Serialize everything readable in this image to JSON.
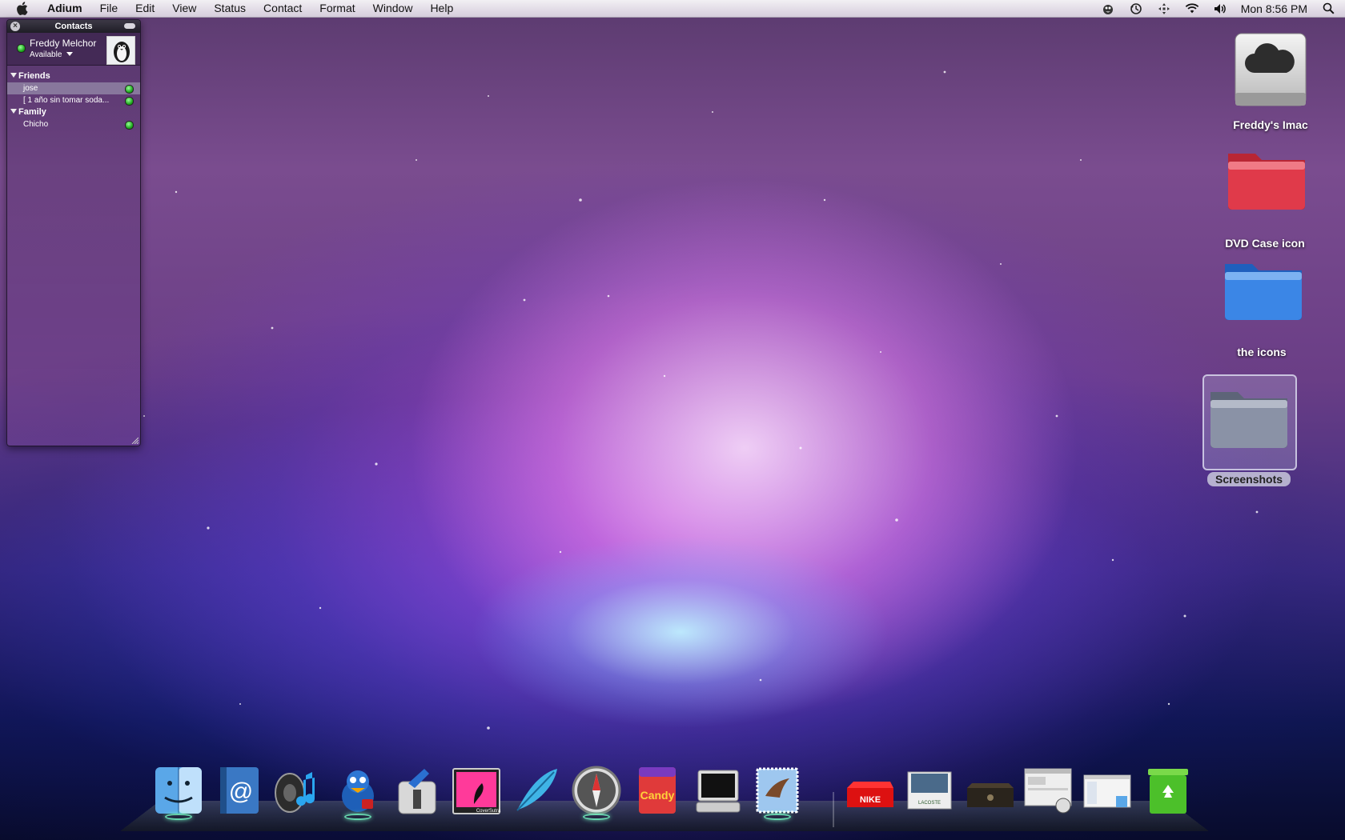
{
  "menubar": {
    "apple_icon": "apple-logo-icon",
    "app_name": "Adium",
    "items": [
      "File",
      "Edit",
      "View",
      "Status",
      "Contact",
      "Format",
      "Window",
      "Help"
    ],
    "tray_icons": [
      "adium-duck-icon",
      "time-machine-icon",
      "spaces-icon",
      "wifi-icon",
      "volume-icon"
    ],
    "clock": "Mon 8:56 PM",
    "spotlight_icon": "spotlight-search-icon"
  },
  "contacts_window": {
    "title": "Contacts",
    "account": {
      "name": "Freddy Melchor",
      "status": "Available"
    },
    "groups": [
      {
        "name": "Friends",
        "buddies": [
          {
            "name": "jose",
            "selected": true
          },
          {
            "name": "[ 1 año sin tomar soda...",
            "selected": false
          }
        ]
      },
      {
        "name": "Family",
        "buddies": [
          {
            "name": "Chicho",
            "selected": false
          }
        ]
      }
    ]
  },
  "desktop_icons": [
    {
      "label": "Freddy's Imac",
      "kind": "hard-drive-icon"
    },
    {
      "label": "DVD Case icon",
      "kind": "folder-icon"
    },
    {
      "label": "the icons",
      "kind": "folder-icon"
    },
    {
      "label": "Screenshots",
      "kind": "folder-icon",
      "selected": true
    }
  ],
  "dock": {
    "apps": [
      "finder-icon",
      "address-book-icon",
      "itunes-icon",
      "adium-icon",
      "system-preferences-icon",
      "coversutra-icon",
      "quill-icon",
      "safari-icon",
      "candybar-icon",
      "terminal-icon",
      "mail-icon"
    ],
    "docked": [
      "nike-box-icon",
      "lacoste-box-icon",
      "dark-box-icon",
      "window-preview-icon",
      "finder-window-icon",
      "trash-icon"
    ],
    "coversutra_text": "CoverSutra",
    "candy_text": "Candy",
    "nike_text": "NIKE",
    "lacoste_text": "LACOSTE"
  },
  "colors": {
    "status_green": "#2a2",
    "folder_red": "#e03a4a",
    "folder_blue": "#3b86e6",
    "folder_gray": "#8a92a6"
  }
}
